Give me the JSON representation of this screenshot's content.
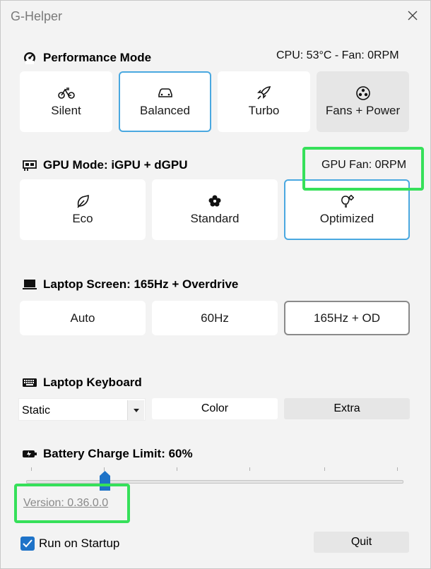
{
  "window": {
    "title": "G-Helper",
    "close_label": "close"
  },
  "performance": {
    "title": "Performance Mode",
    "status": "CPU: 53°C -  Fan: 0RPM",
    "modes": [
      {
        "label": "Silent",
        "icon": "bicycle-icon"
      },
      {
        "label": "Balanced",
        "icon": "car-icon"
      },
      {
        "label": "Turbo",
        "icon": "rocket-icon"
      },
      {
        "label": "Fans + Power",
        "icon": "fan-icon"
      }
    ],
    "selected": "Balanced"
  },
  "gpu": {
    "title": "GPU Mode: iGPU + dGPU",
    "fan": "GPU Fan: 0RPM",
    "modes": [
      {
        "label": "Eco",
        "icon": "leaf-icon"
      },
      {
        "label": "Standard",
        "icon": "flower-icon"
      },
      {
        "label": "Optimized",
        "icon": "lightbulb-gear-icon"
      }
    ],
    "selected": "Optimized"
  },
  "screen": {
    "title": "Laptop Screen: 165Hz + Overdrive",
    "modes": [
      {
        "label": "Auto"
      },
      {
        "label": "60Hz"
      },
      {
        "label": "165Hz + OD"
      }
    ],
    "selected": "165Hz + OD"
  },
  "keyboard": {
    "title": "Laptop Keyboard",
    "mode_value": "Static",
    "color_label": "Color",
    "extra_label": "Extra"
  },
  "battery": {
    "title": "Battery Charge Limit: 60%",
    "limit_percent": 60,
    "slider_fraction": 0.2
  },
  "footer": {
    "version": "Version: 0.36.0.0",
    "run_on_startup_label": "Run on Startup",
    "run_on_startup_checked": true,
    "quit_label": "Quit"
  },
  "colors": {
    "accent_blue": "#4aa8e0",
    "checkbox_blue": "#1e73c8",
    "highlight_green": "#36e05a"
  }
}
